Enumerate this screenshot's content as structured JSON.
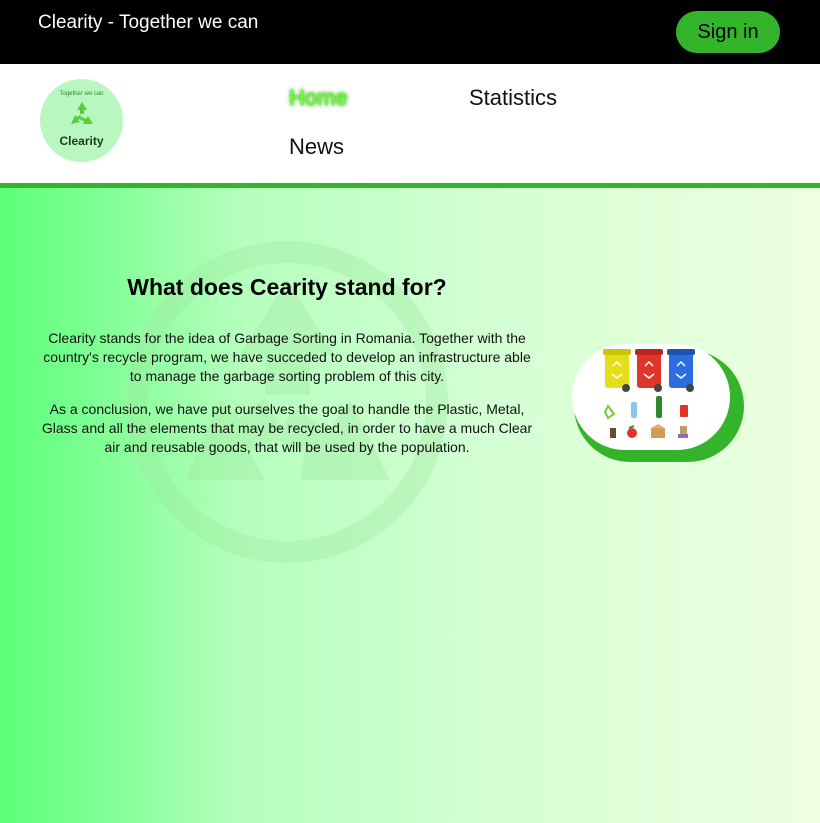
{
  "header": {
    "brand": "Clearity - Together we can",
    "sign_in_label": "Sign in"
  },
  "logo": {
    "tagline": "Together we can",
    "name": "Clearity",
    "icon": "recycle-icon"
  },
  "nav": {
    "items": [
      {
        "label": "Home",
        "active": true
      },
      {
        "label": "Statistics",
        "active": false
      },
      {
        "label": "News",
        "active": false
      }
    ]
  },
  "main": {
    "heading": "What does Cearity stand for?",
    "paragraphs": [
      "Clearity stands for the idea of Garbage Sorting in Romania. Together with the country's recycle program, we have succeded to develop an infrastructure able to manage the garbage sorting problem of this city.",
      "As a conclusion, we have put ourselves the goal to handle the Plastic, Metal, Glass and all the elements that may be recycled, in order to have a much Clear air and reusable goods, that will be used by the population."
    ],
    "image": "recycle-bins-illustration"
  },
  "colors": {
    "accent": "#34b42a",
    "active_nav": "#66ff33",
    "topbar": "#000000"
  }
}
